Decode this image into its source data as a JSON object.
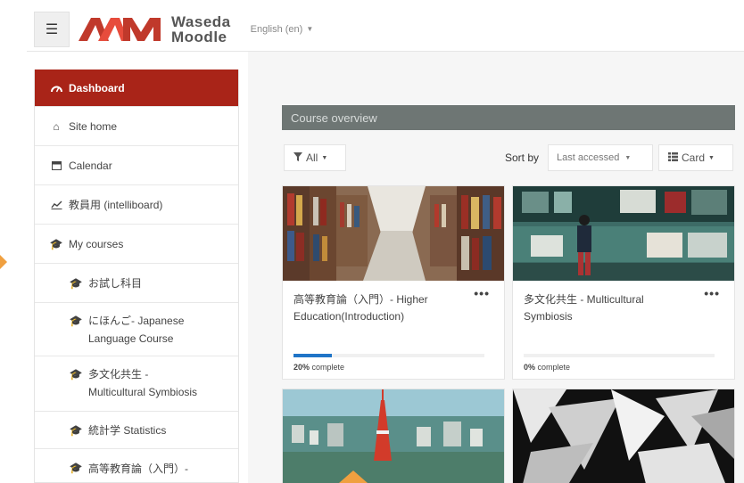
{
  "header": {
    "logo_line1": "Waseda",
    "logo_line2": "Moodle",
    "language": "English (en)"
  },
  "sidebar": {
    "items": [
      {
        "label": "Dashboard",
        "icon": "dashboard-icon",
        "active": true
      },
      {
        "label": "Site home",
        "icon": "home-icon"
      },
      {
        "label": "Calendar",
        "icon": "calendar-icon"
      },
      {
        "label": "教員用 (intelliboard)",
        "icon": "chart-line-icon"
      },
      {
        "label": "My courses",
        "icon": "graduation-cap-icon"
      },
      {
        "label": "お試し科目",
        "icon": "graduation-cap-icon"
      },
      {
        "label": "にほんご- Japanese",
        "label2": "Language Course",
        "icon": "graduation-cap-icon"
      },
      {
        "label": "多文化共生 -",
        "label2": "Multicultural Symbiosis",
        "icon": "graduation-cap-icon"
      },
      {
        "label": "統計学 Statistics",
        "icon": "graduation-cap-icon"
      },
      {
        "label": "高等教育論（入門）-",
        "icon": "graduation-cap-icon"
      }
    ]
  },
  "main": {
    "overview_title": "Course overview",
    "filter_label": "All",
    "sort_by_label": "Sort by",
    "sort_value": "Last accessed",
    "view_value": "Card"
  },
  "courses": [
    {
      "title": "高等教育論（入門）- Higher Education(Introduction)",
      "progress_percent": 20,
      "progress_text": "20%",
      "complete_label": "complete"
    },
    {
      "title": "多文化共生 - Multicultural Symbiosis",
      "progress_percent": 0,
      "progress_text": "0%",
      "complete_label": "complete"
    }
  ],
  "colors": {
    "active_nav": "#a92418",
    "overview_bar": "#6e7674",
    "progress": "#1f74c7",
    "marker": "#f0a040"
  }
}
